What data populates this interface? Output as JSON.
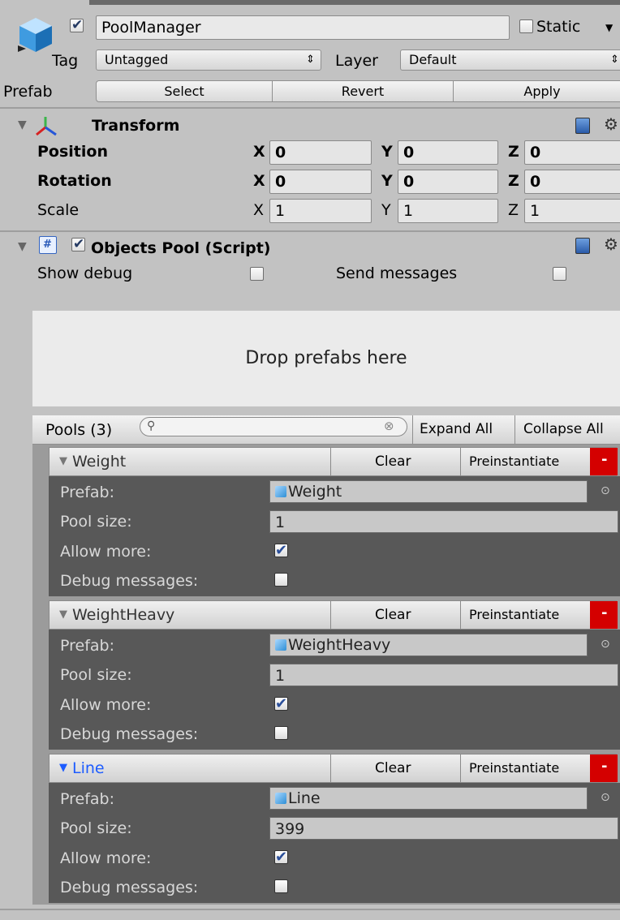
{
  "header": {
    "object_name": "PoolManager",
    "active": true,
    "static_label": "Static",
    "static_checked": false,
    "tag_label": "Tag",
    "tag_value": "Untagged",
    "layer_label": "Layer",
    "layer_value": "Default",
    "prefab_label": "Prefab",
    "select_label": "Select",
    "revert_label": "Revert",
    "apply_label": "Apply"
  },
  "transform": {
    "title": "Transform",
    "rows": [
      {
        "label": "Position",
        "x": "0",
        "y": "0",
        "z": "0"
      },
      {
        "label": "Rotation",
        "x": "0",
        "y": "0",
        "z": "0"
      },
      {
        "label": "Scale",
        "x": "1",
        "y": "1",
        "z": "1"
      }
    ],
    "x_label": "X",
    "y_label": "Y",
    "z_label": "Z"
  },
  "script": {
    "title": "Objects Pool (Script)",
    "enabled": true,
    "show_debug_label": "Show debug",
    "show_debug": false,
    "send_messages_label": "Send messages",
    "send_messages": false,
    "drop_text": "Drop prefabs here",
    "pools_label": "Pools (3)",
    "search_placeholder": "",
    "expand_all": "Expand All",
    "collapse_all": "Collapse All"
  },
  "pools": [
    {
      "name": "Weight",
      "highlighted": false,
      "clear": "Clear",
      "preinstantiate": "Preinstantiate",
      "remove": "-",
      "prefab_label": "Prefab:",
      "prefab": "Weight",
      "pool_size_label": "Pool size:",
      "pool_size": "1",
      "allow_more_label": "Allow more:",
      "allow_more": true,
      "debug_label": "Debug messages:",
      "debug": false
    },
    {
      "name": "WeightHeavy",
      "highlighted": false,
      "clear": "Clear",
      "preinstantiate": "Preinstantiate",
      "remove": "-",
      "prefab_label": "Prefab:",
      "prefab": "WeightHeavy",
      "pool_size_label": "Pool size:",
      "pool_size": "1",
      "allow_more_label": "Allow more:",
      "allow_more": true,
      "debug_label": "Debug messages:",
      "debug": false
    },
    {
      "name": "Line",
      "highlighted": true,
      "clear": "Clear",
      "preinstantiate": "Preinstantiate",
      "remove": "-",
      "prefab_label": "Prefab:",
      "prefab": "Line",
      "pool_size_label": "Pool size:",
      "pool_size": "399",
      "allow_more_label": "Allow more:",
      "allow_more": true,
      "debug_label": "Debug messages:",
      "debug": false
    }
  ],
  "colors": {
    "highlight_text": "#1d5cff",
    "remove_button": "#d40000",
    "pool_body": "#585858"
  }
}
